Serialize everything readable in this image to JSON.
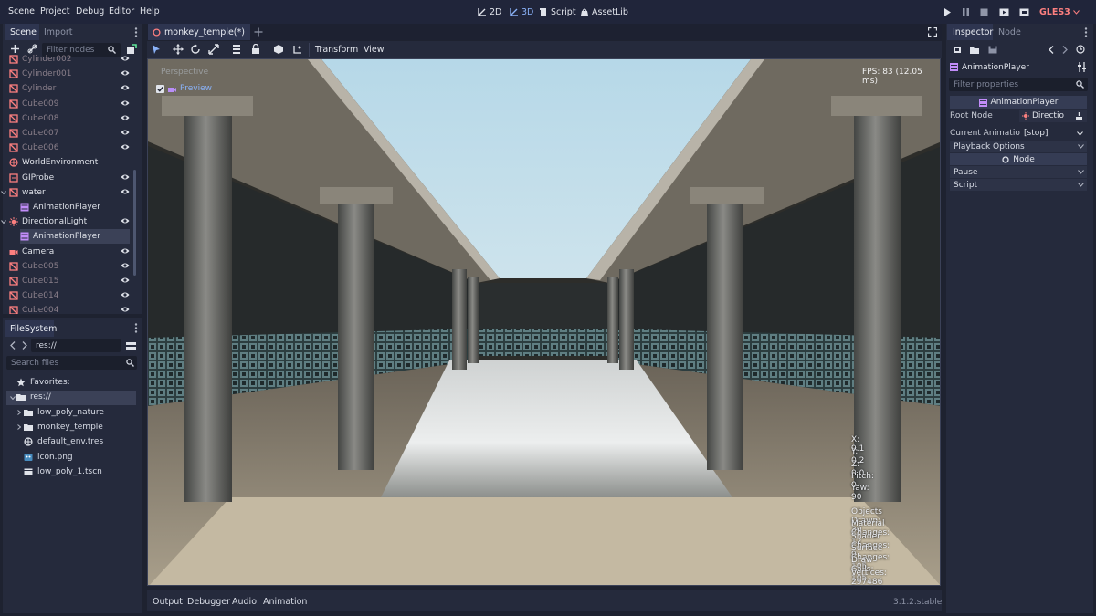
{
  "menubar": {
    "menus": [
      "Scene",
      "Project",
      "Debug",
      "Editor",
      "Help"
    ],
    "modes": [
      "2D",
      "3D",
      "Script",
      "AssetLib"
    ],
    "renderer": "GLES3"
  },
  "scene_dock": {
    "tabs": [
      "Scene",
      "Import"
    ],
    "filter_placeholder": "Filter nodes",
    "nodes": [
      {
        "label": "Cylinder002",
        "type": "mesh",
        "dim": true
      },
      {
        "label": "Cylinder001",
        "type": "mesh",
        "dim": true
      },
      {
        "label": "Cylinder",
        "type": "mesh",
        "dim": true
      },
      {
        "label": "Cube009",
        "type": "mesh",
        "dim": true
      },
      {
        "label": "Cube008",
        "type": "mesh",
        "dim": true
      },
      {
        "label": "Cube007",
        "type": "mesh",
        "dim": true
      },
      {
        "label": "Cube006",
        "type": "mesh",
        "dim": true
      },
      {
        "label": "WorldEnvironment",
        "type": "world",
        "dim": false
      },
      {
        "label": "GIProbe",
        "type": "giprobe",
        "dim": false
      },
      {
        "label": "water",
        "type": "mesh",
        "dim": false
      },
      {
        "label": "AnimationPlayer",
        "type": "anim",
        "dim": false
      },
      {
        "label": "DirectionalLight",
        "type": "light",
        "dim": false
      },
      {
        "label": "AnimationPlayer",
        "type": "anim",
        "dim": false,
        "selected": true
      },
      {
        "label": "Camera",
        "type": "camera",
        "dim": false
      },
      {
        "label": "Cube005",
        "type": "mesh",
        "dim": true
      },
      {
        "label": "Cube015",
        "type": "mesh",
        "dim": true
      },
      {
        "label": "Cube014",
        "type": "mesh",
        "dim": true
      },
      {
        "label": "Cube004",
        "type": "mesh",
        "dim": true
      }
    ]
  },
  "filesystem_dock": {
    "tab": "FileSystem",
    "path": "res://",
    "search_placeholder": "Search files",
    "items": [
      {
        "label": "Favorites:",
        "type": "star"
      },
      {
        "label": "res://",
        "type": "folder"
      },
      {
        "label": "low_poly_nature",
        "type": "folder"
      },
      {
        "label": "monkey_temple",
        "type": "folder"
      },
      {
        "label": "default_env.tres",
        "type": "globe"
      },
      {
        "label": "icon.png",
        "type": "image"
      },
      {
        "label": "low_poly_1.tscn",
        "type": "scene"
      }
    ]
  },
  "editor": {
    "scene_tab": "monkey_temple(*)",
    "toolbar_menus": [
      "Transform",
      "View"
    ],
    "viewport": {
      "perspective_label": "Perspective",
      "preview_label": "Preview",
      "fps": "FPS: 83 (12.05 ms)",
      "camera_info": [
        "X: 9.1",
        "Y: 0.2",
        "Z: 0.0",
        "Pitch: 0",
        "Yaw: 90"
      ],
      "render_info": [
        "Objects Drawn: 30",
        "Material Changes: 12",
        "Shader Changes: 9",
        "Surface Changes: 105",
        "Draw Calls: 105",
        "Vertices: 297486"
      ]
    },
    "bottom_tabs": [
      "Output",
      "Debugger",
      "Audio",
      "Animation"
    ],
    "version": "3.1.2.stable"
  },
  "inspector": {
    "tabs": [
      "Inspector",
      "Node"
    ],
    "node_name": "AnimationPlayer",
    "filter_placeholder": "Filter properties",
    "class_header": "AnimationPlayer",
    "root_node_label": "Root Node",
    "root_node_value": "Directio",
    "current_animation_label": "Current Animatio",
    "current_animation_value": "[stop]",
    "sections": [
      "Playback Options",
      "Node",
      "Pause",
      "Script"
    ]
  },
  "colors": {
    "accent": "#8ab2f8",
    "background": "#1e2230",
    "panel": "#252a3c",
    "mesh_icon": "#fc7f7f",
    "anim_icon": "#c18cf8"
  }
}
